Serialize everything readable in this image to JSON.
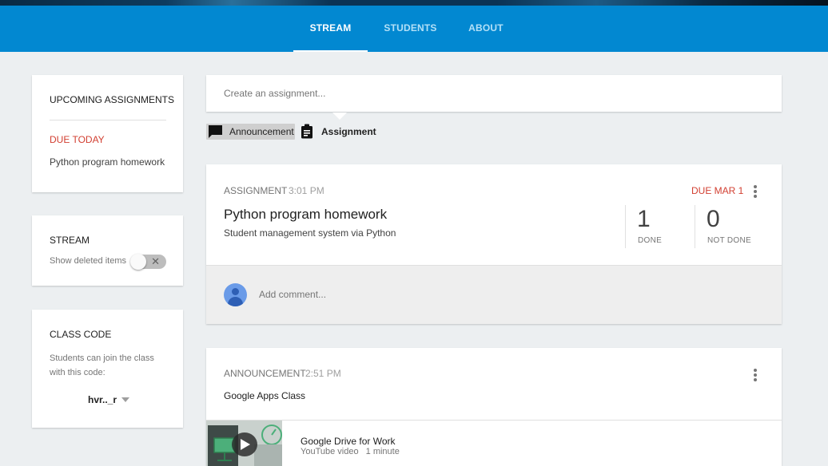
{
  "nav": {
    "tabs": [
      {
        "label": "STREAM",
        "active": true
      },
      {
        "label": "STUDENTS",
        "active": false
      },
      {
        "label": "ABOUT",
        "active": false
      }
    ]
  },
  "sidebar": {
    "upcoming": {
      "title": "UPCOMING ASSIGNMENTS",
      "due_label": "DUE TODAY",
      "item": "Python program homework"
    },
    "stream": {
      "title": "STREAM",
      "toggle_label": "Show deleted items",
      "toggle_on": false
    },
    "class_code": {
      "title": "CLASS CODE",
      "hint_line1": "Students can join the class",
      "hint_line2": "with this code:",
      "code": "hvr.._r"
    }
  },
  "composer": {
    "placeholder": "Create an assignment...",
    "announcement_label": "Announcement",
    "assignment_label": "Assignment"
  },
  "posts": [
    {
      "type": "ASSIGNMENT",
      "time": "3:01 PM",
      "due": "DUE MAR 1",
      "title": "Python program homework",
      "description": "Student management system via Python",
      "done_count": "1",
      "done_label": "DONE",
      "not_done_count": "0",
      "not_done_label": "NOT DONE",
      "comment_placeholder": "Add comment..."
    },
    {
      "type": "ANNOUNCEMENT",
      "time": "2:51 PM",
      "text": "Google Apps Class",
      "attachment_title": "Google Drive for Work",
      "attachment_type": "YouTube video",
      "attachment_duration": "1 minute"
    }
  ],
  "colors": {
    "nav_bg": "#0288d1",
    "accent_red": "#d23f31",
    "page_bg": "#eceff1"
  },
  "icons": {
    "announcement": "speech-bubble-icon",
    "assignment": "clipboard-icon",
    "more": "more-vert-icon",
    "dropdown": "caret-down-icon",
    "toggle_off": "close-icon",
    "play": "play-icon"
  }
}
